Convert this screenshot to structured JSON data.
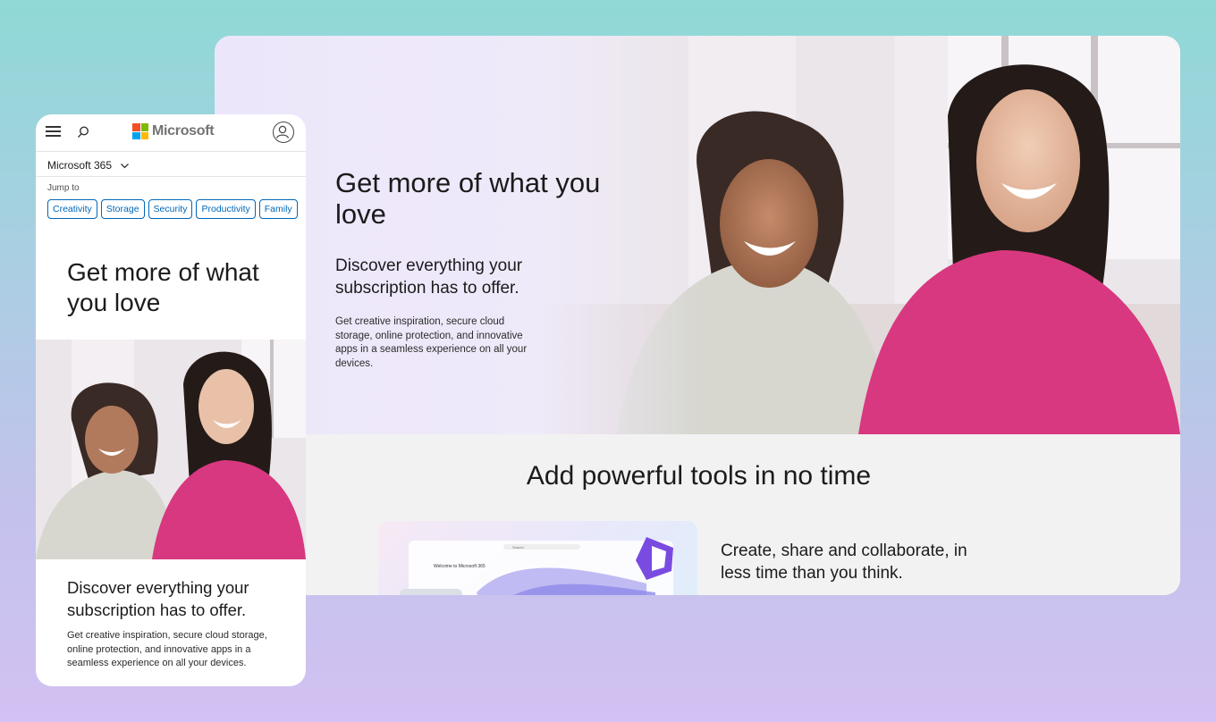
{
  "desktop": {
    "hero_title": "Get more of what you love",
    "hero_subtitle": "Discover everything your subscription has to offer.",
    "hero_body": "Get creative inspiration, secure cloud storage, online protection, and innovative apps in a seamless experience on all your devices.",
    "tools_title": "Add powerful tools in no time",
    "tools_text": "Create, share and collaborate, in less time than you think.",
    "thumb_welcome": "Welcome to Microsoft 365",
    "thumb_search": "Search"
  },
  "mobile": {
    "logo_text": "Microsoft",
    "nav_label": "Microsoft 365",
    "jump_label": "Jump to",
    "chips": [
      "Creativity",
      "Storage",
      "Security",
      "Productivity",
      "Family"
    ],
    "hero_title": "Get more of what you love",
    "hero_subtitle": "Discover everything your subscription has to offer.",
    "hero_body": "Get creative inspiration, secure cloud storage, online protection, and innovative apps in a seamless experience on all your devices."
  },
  "colors": {
    "brand_blue": "#0067b8",
    "logo_red": "#f25022",
    "logo_green": "#7fba00",
    "logo_blue": "#00a4ef",
    "logo_yellow": "#ffb900"
  },
  "icons": {
    "menu": "hamburger-menu-icon",
    "search": "search-icon",
    "account": "account-icon",
    "dropdown": "chevron-down-icon"
  }
}
